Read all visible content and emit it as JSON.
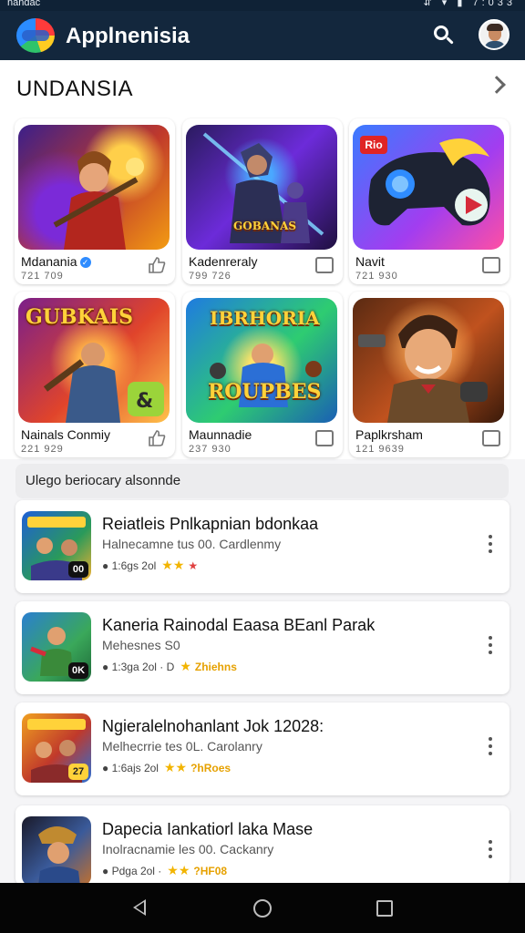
{
  "status_bar": {
    "left_text": "nandac",
    "right_text": "⇵ ▾ ▮ 7:033"
  },
  "app_bar": {
    "title": "Applnenisia",
    "logo_icon": "rainbow-app-logo",
    "search_icon": "search-icon",
    "avatar_icon": "user-avatar"
  },
  "section": {
    "title": "UNDANSIA",
    "chevron_icon": "chevron-right-icon"
  },
  "cards": [
    {
      "name": "Mdanania",
      "verified": true,
      "sub": "721 709",
      "art_text": "",
      "action_icon": "thumbs-up-icon"
    },
    {
      "name": "Kadenreraly",
      "verified": false,
      "sub": "799 726",
      "art_text": "GOBANAS",
      "action_icon": "bookmark-icon"
    },
    {
      "name": "Navit",
      "verified": false,
      "sub": "721 930",
      "art_text": "Rio",
      "action_icon": "bookmark-icon"
    },
    {
      "name": "Nainals Conmiy",
      "verified": false,
      "sub": "221 929",
      "art_text": "GUBKAIS",
      "action_icon": "thumbs-up-icon"
    },
    {
      "name": "Maunnadie",
      "verified": false,
      "sub": "237 930",
      "art_text": "IBRHORIA",
      "art_text2": "ROUPBES",
      "action_icon": "bookmark-icon"
    },
    {
      "name": "Paplkrsham",
      "verified": false,
      "sub": "121 9639",
      "art_text": "",
      "action_icon": "bookmark-icon"
    }
  ],
  "list_label": "Ulego beriocary alsonnde",
  "list": [
    {
      "title": "Reiatleis Pnlkapnian bdonkaa",
      "developer": "Halnecamne tus 00. Cardlenmy",
      "downloads": "1:6gs 2ol",
      "stars": "★★",
      "extra": "★",
      "badge": "00"
    },
    {
      "title": "Kaneria Rainodal Eaasa BEanl Parak",
      "developer": "Mehesnes S0",
      "downloads": "1:3ga 2ol · D",
      "stars": "★",
      "extra": "Zhiehns",
      "badge": "0K"
    },
    {
      "title": "Ngieralelnohanlant Jok 12028:",
      "developer": "Melhecrrie tes 0L. Carolanry",
      "downloads": "1:6ajs 2ol",
      "stars": "★★",
      "extra": "?hRoes",
      "badge": "27"
    },
    {
      "title": "Dapecia Iankatiorl laka Mase",
      "developer": "Inolracnamie les 00. Cackanry",
      "downloads": "Pdga 2ol ·",
      "stars": "★★",
      "extra": "?HF08",
      "badge": ""
    }
  ],
  "nav_bar": {
    "back_icon": "back-icon",
    "home_icon": "home-icon",
    "recents_icon": "recents-icon"
  },
  "colors": {
    "app_bar": "#13273d",
    "accent_star": "#f2b400",
    "verified": "#2f8cff",
    "navbar": "#050505"
  }
}
